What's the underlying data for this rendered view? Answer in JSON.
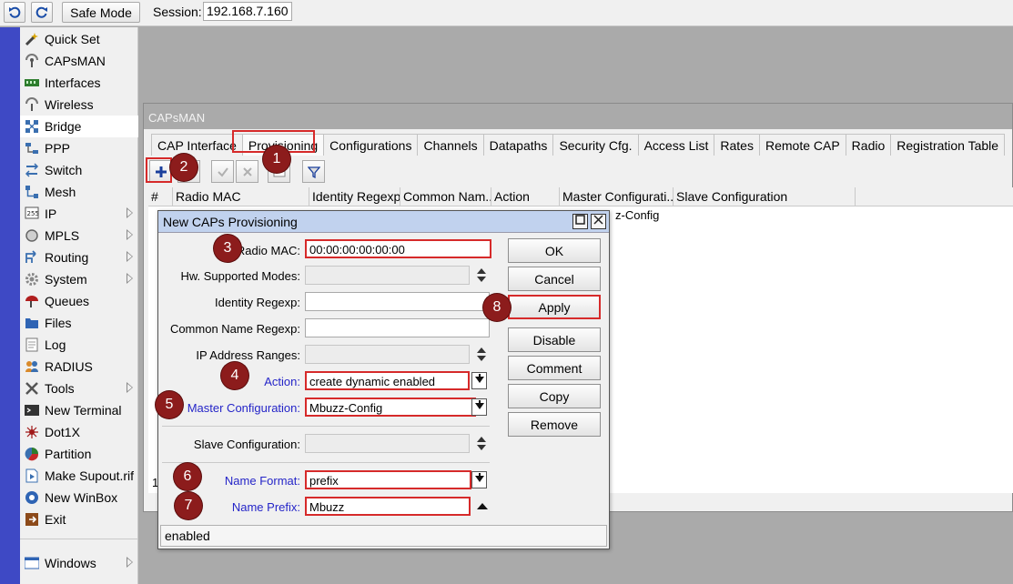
{
  "topbar": {
    "undo_icon": "undo-icon",
    "redo_icon": "redo-icon",
    "safe_mode_label": "Safe Mode",
    "session_label": "Session:",
    "session_value": "192.168.7.160"
  },
  "sidebar": {
    "items": [
      {
        "label": "Quick Set",
        "icon": "wand-icon"
      },
      {
        "label": "CAPsMAN",
        "icon": "capsman-icon"
      },
      {
        "label": "Interfaces",
        "icon": "interfaces-icon"
      },
      {
        "label": "Wireless",
        "icon": "wireless-icon"
      },
      {
        "label": "Bridge",
        "icon": "bridge-icon"
      },
      {
        "label": "PPP",
        "icon": "ppp-icon"
      },
      {
        "label": "Switch",
        "icon": "switch-icon"
      },
      {
        "label": "Mesh",
        "icon": "mesh-icon"
      },
      {
        "label": "IP",
        "icon": "ip-icon"
      },
      {
        "label": "MPLS",
        "icon": "mpls-icon"
      },
      {
        "label": "Routing",
        "icon": "routing-icon"
      },
      {
        "label": "System",
        "icon": "system-icon"
      },
      {
        "label": "Queues",
        "icon": "queues-icon"
      },
      {
        "label": "Files",
        "icon": "files-icon"
      },
      {
        "label": "Log",
        "icon": "log-icon"
      },
      {
        "label": "RADIUS",
        "icon": "radius-icon"
      },
      {
        "label": "Tools",
        "icon": "tools-icon"
      },
      {
        "label": "New Terminal",
        "icon": "terminal-icon"
      },
      {
        "label": "Dot1X",
        "icon": "dot1x-icon"
      },
      {
        "label": "Partition",
        "icon": "partition-icon"
      },
      {
        "label": "Make Supout.rif",
        "icon": "supout-icon"
      },
      {
        "label": "New WinBox",
        "icon": "winbox-icon"
      },
      {
        "label": "Exit",
        "icon": "exit-icon"
      }
    ],
    "windows_label": "Windows"
  },
  "capsman": {
    "title": "CAPsMAN",
    "tabs": [
      "CAP Interface",
      "Provisioning",
      "Configurations",
      "Channels",
      "Datapaths",
      "Security Cfg.",
      "Access List",
      "Rates",
      "Remote CAP",
      "Radio",
      "Registration Table"
    ],
    "columns": [
      "#",
      "Radio MAC",
      "Identity Regexp",
      "Common Nam...",
      "Action",
      "Master Configurati...",
      "Slave Configuration"
    ],
    "row_master_fragment": "z-Config",
    "footer_fragment": "1"
  },
  "dialog": {
    "title": "New CAPs Provisioning",
    "fields": {
      "radio_mac": {
        "label": "Radio MAC:",
        "value": "00:00:00:00:00:00"
      },
      "hw_modes": {
        "label": "Hw. Supported Modes:",
        "value": ""
      },
      "identity_regexp": {
        "label": "Identity Regexp:",
        "value": ""
      },
      "common_name_regexp": {
        "label": "Common Name Regexp:",
        "value": ""
      },
      "ip_ranges": {
        "label": "IP Address Ranges:",
        "value": ""
      },
      "action": {
        "label": "Action:",
        "value": "create dynamic enabled"
      },
      "master_config": {
        "label": "Master Configuration:",
        "value": "Mbuzz-Config"
      },
      "slave_config": {
        "label": "Slave Configuration:",
        "value": ""
      },
      "name_format": {
        "label": "Name Format:",
        "value": "prefix"
      },
      "name_prefix": {
        "label": "Name Prefix:",
        "value": "Mbuzz"
      }
    },
    "buttons": {
      "ok": "OK",
      "cancel": "Cancel",
      "apply": "Apply",
      "disable": "Disable",
      "comment": "Comment",
      "copy": "Copy",
      "remove": "Remove"
    },
    "status": "enabled"
  },
  "markers": [
    "1",
    "2",
    "3",
    "4",
    "5",
    "6",
    "7",
    "8"
  ],
  "colors": {
    "accent_strip": "#3e49c5",
    "highlight_red": "#d62a2a",
    "marker_red": "#8c1c1c",
    "link_blue": "#2525c8"
  }
}
